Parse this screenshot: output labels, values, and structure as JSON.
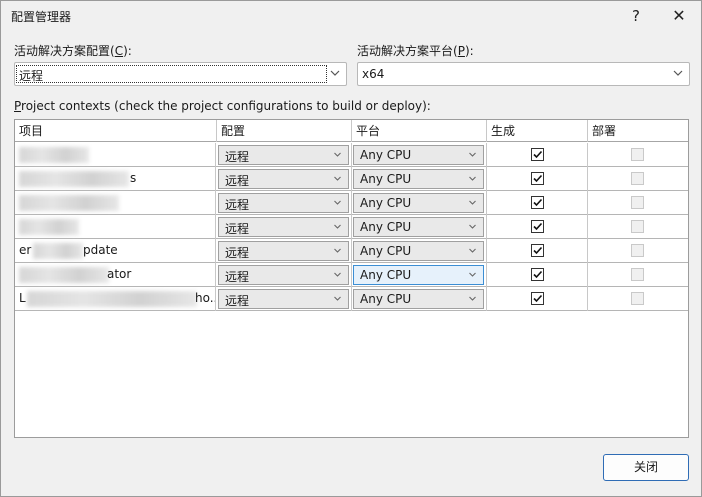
{
  "window": {
    "title": "配置管理器",
    "help_glyph": "?",
    "close_glyph": "✕"
  },
  "active_config": {
    "label": "活动解决方案配置(C):",
    "label_pre": "活动解决方案配置(",
    "label_key": "C",
    "label_post": "):",
    "value": "远程"
  },
  "active_platform": {
    "label": "活动解决方案平台(P):",
    "label_pre": "活动解决方案平台(",
    "label_key": "P",
    "label_post": "):",
    "value": "x64"
  },
  "contexts_label": {
    "key": "P",
    "rest": "roject contexts (check the project configurations to build or deploy):"
  },
  "columns": {
    "project": "项目",
    "config": "配置",
    "platform": "平台",
    "build": "生成",
    "deploy": "部署"
  },
  "rows": [
    {
      "name": "",
      "config": "远程",
      "platform": "Any CPU",
      "build": true,
      "deploy": false
    },
    {
      "name": "s",
      "config": "远程",
      "platform": "Any CPU",
      "build": true,
      "deploy": false
    },
    {
      "name": "",
      "config": "远程",
      "platform": "Any CPU",
      "build": true,
      "deploy": false
    },
    {
      "name": "",
      "config": "远程",
      "platform": "Any CPU",
      "build": true,
      "deploy": false
    },
    {
      "name": "pdate",
      "config": "远程",
      "platform": "Any CPU",
      "build": true,
      "deploy": false
    },
    {
      "name": "ator",
      "config": "远程",
      "platform": "Any CPU",
      "build": true,
      "deploy": false
    },
    {
      "name": "ho...",
      "config": "远程",
      "platform": "Any CPU",
      "build": true,
      "deploy": false
    }
  ],
  "row_name_prefixes": [
    "",
    "",
    "",
    "",
    "er",
    "",
    "L"
  ],
  "close_button": "关闭",
  "colors": {
    "accent": "#2f6cb5",
    "hover": "#e6f1fb"
  }
}
